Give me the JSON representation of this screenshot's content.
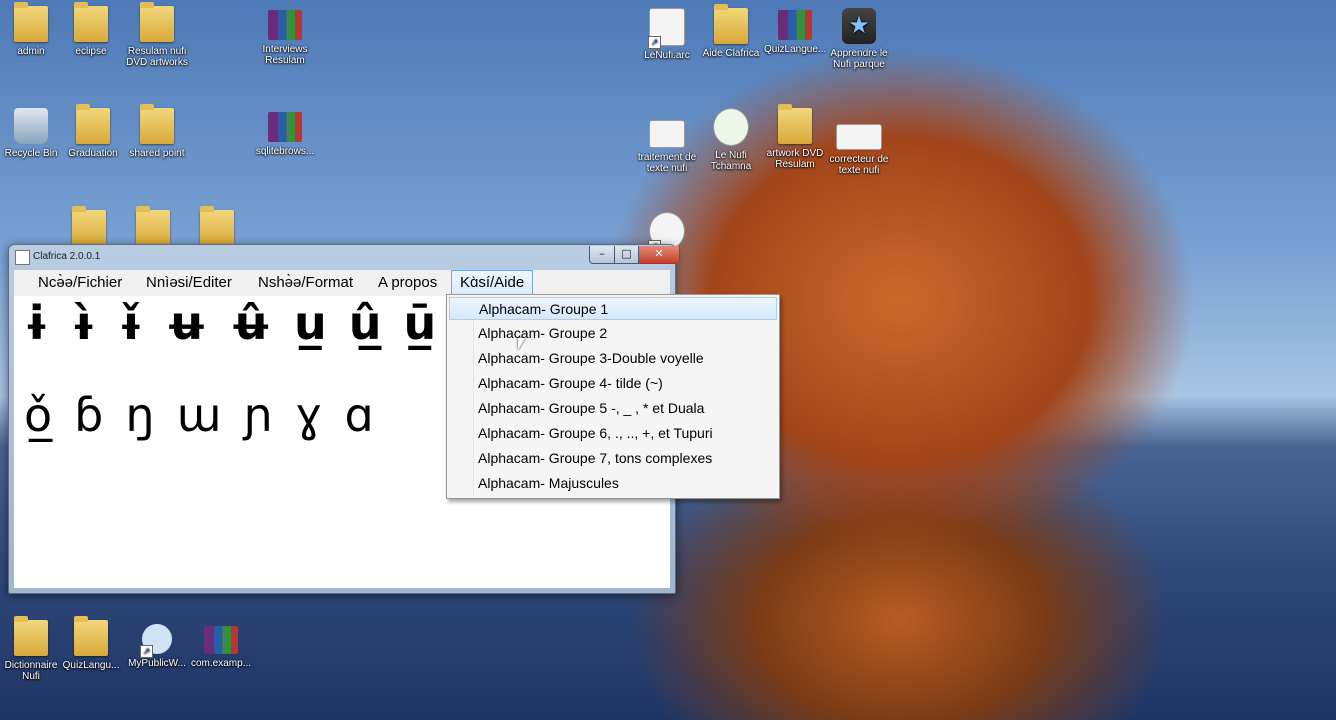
{
  "desktop": {
    "icons": [
      {
        "label": "admin",
        "kind": "folder-user",
        "icon": "user-folder-icon"
      },
      {
        "label": "eclipse",
        "kind": "folder",
        "icon": "folder-icon"
      },
      {
        "label": "Resulam nufi DVD artworks",
        "kind": "folder",
        "icon": "folder-icon"
      },
      {
        "label": "Interviews Resulam",
        "kind": "rar",
        "icon": "rar-archive-icon"
      },
      {
        "label": "Recycle Bin",
        "kind": "bin",
        "icon": "recycle-bin-icon"
      },
      {
        "label": "Graduation",
        "kind": "folder",
        "icon": "folder-icon"
      },
      {
        "label": "shared point",
        "kind": "folder",
        "icon": "folder-icon"
      },
      {
        "label": "sqlitebrows...",
        "kind": "rar",
        "icon": "rar-archive-icon"
      },
      {
        "label": "",
        "kind": "folder",
        "icon": "folder-icon"
      },
      {
        "label": "",
        "kind": "folder",
        "icon": "folder-icon"
      },
      {
        "label": "",
        "kind": "folder",
        "icon": "folder-icon"
      },
      {
        "label": "LeNufi.arc",
        "kind": "app",
        "icon": "app-shortcut-icon"
      },
      {
        "label": "Aide Clafrica",
        "kind": "folder",
        "icon": "folder-icon"
      },
      {
        "label": "QuizLangue...",
        "kind": "rar",
        "icon": "rar-archive-icon"
      },
      {
        "label": "Apprendre le Nufi parque",
        "kind": "star",
        "icon": "star-app-icon"
      },
      {
        "label": "traitement de texte nufi",
        "kind": "app",
        "icon": "document-icon"
      },
      {
        "label": "Le Nufi Tchamna",
        "kind": "app",
        "icon": "book-icon"
      },
      {
        "label": "artwork DVD Resulam",
        "kind": "folder",
        "icon": "folder-icon"
      },
      {
        "label": "correcteur de texte nufi",
        "kind": "app",
        "icon": "app-window-icon"
      },
      {
        "label": "",
        "kind": "app",
        "icon": "app-shortcut-icon"
      },
      {
        "label": "Dictionnaire Nufi",
        "kind": "folder",
        "icon": "folder-icon"
      },
      {
        "label": "QuizLangu...",
        "kind": "folder",
        "icon": "folder-icon"
      },
      {
        "label": "MyPublicW...",
        "kind": "wifi",
        "icon": "wifi-hotspot-icon"
      },
      {
        "label": "com.examp...",
        "kind": "rar",
        "icon": "rar-archive-icon"
      }
    ]
  },
  "window": {
    "title": "Clafrica 2.0.0.1",
    "controls": {
      "minimize": "–",
      "maximize": "□",
      "close": "✕"
    },
    "menu": [
      {
        "label": "Ncə̀ə/Fichier"
      },
      {
        "label": "Nnìəsi/Editer"
      },
      {
        "label": "Nshə̀ə/Format"
      },
      {
        "label": "A propos"
      },
      {
        "label": "Kɑ̀sí/Aide"
      }
    ],
    "row1": [
      "ɨ",
      "ɨ̀",
      "ɨ̌",
      "ʉ",
      "ʉ̂",
      "u̲",
      "û̲",
      "ū̲"
    ],
    "row2": [
      "ǒ̲",
      "ɓ",
      "ŋ",
      "ɯ",
      "ɲ",
      "ɣ",
      "ɑ"
    ]
  },
  "dropdown": {
    "items": [
      "Alphacam- Groupe 1",
      "Alphacam- Groupe 2",
      "Alphacam- Groupe 3-Double voyelle",
      "Alphacam- Groupe 4- tilde (~)",
      "Alphacam- Groupe 5 -, _ , * et Duala",
      "Alphacam- Groupe 6, ., .., +, et Tupuri",
      "Alphacam- Groupe 7, tons complexes",
      "Alphacam- Majuscules"
    ],
    "highlighted_index": 0
  }
}
